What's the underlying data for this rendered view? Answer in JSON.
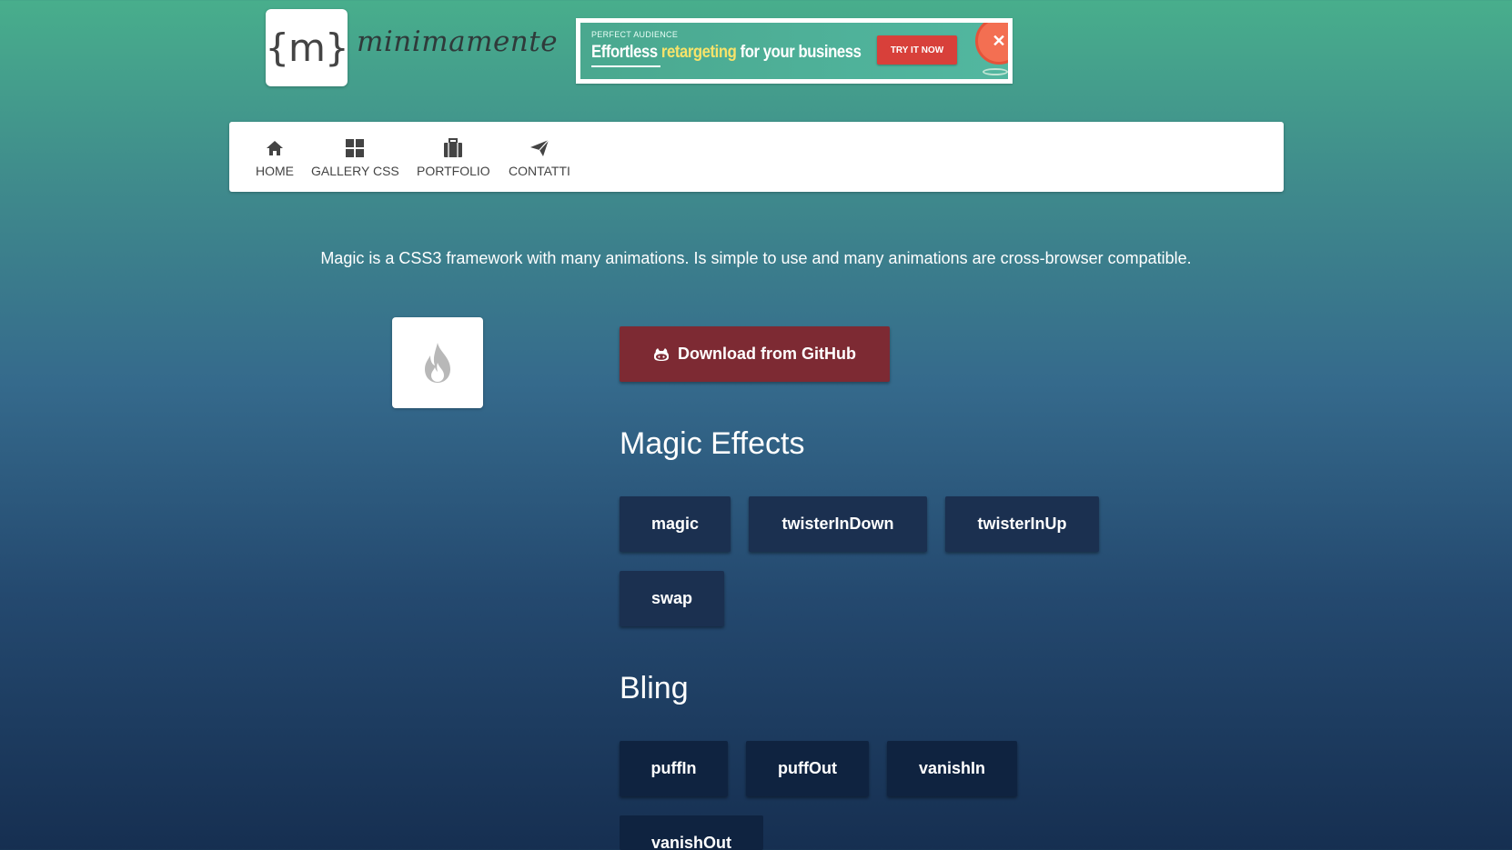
{
  "brand": {
    "logo_mark": "{m}",
    "name": "minimamente"
  },
  "ad": {
    "small": "PERFECT AUDIENCE",
    "headline_pre": "Effortless ",
    "headline_highlight": "retargeting",
    "headline_post": " for your business",
    "cta": "TRY IT NOW"
  },
  "nav": {
    "items": [
      {
        "label": "HOME",
        "icon": "home-icon"
      },
      {
        "label": "GALLERY CSS",
        "icon": "grid-icon"
      },
      {
        "label": "PORTFOLIO",
        "icon": "briefcase-icon"
      },
      {
        "label": "CONTATTI",
        "icon": "paper-plane-icon"
      }
    ]
  },
  "tagline": "Magic is a CSS3 framework with many animations. Is simple to use and many animations are cross-browser compatible.",
  "download": {
    "label": "Download from GitHub",
    "icon": "github-icon",
    "color": "#7d2a33"
  },
  "sections": [
    {
      "title": "Magic Effects",
      "buttons": [
        "magic",
        "twisterInDown",
        "twisterInUp",
        "swap"
      ]
    },
    {
      "title": "Bling",
      "buttons": [
        "puffIn",
        "puffOut",
        "vanishIn",
        "vanishOut"
      ]
    }
  ],
  "colors": {
    "gradient_top": "#48ae8c",
    "gradient_bottom": "#162f51",
    "effect_button": "#1b3050",
    "download_button": "#7d2a33"
  }
}
